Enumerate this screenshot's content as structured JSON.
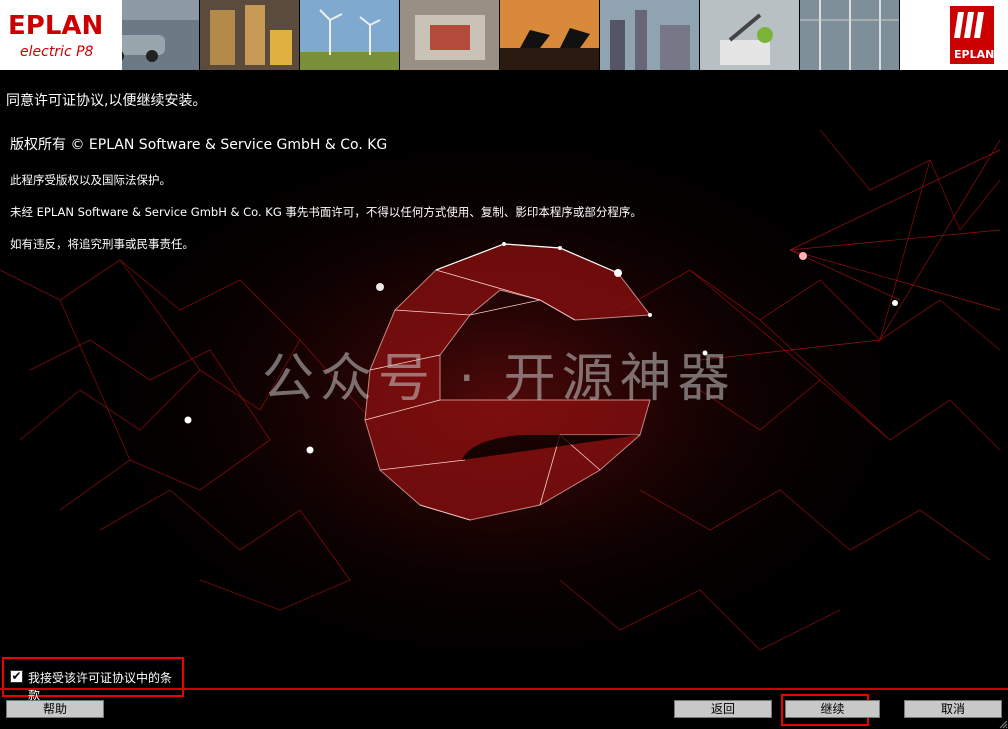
{
  "banner": {
    "logo_left_text": "EPLAN",
    "logo_left_sub": "electric P8",
    "logo_right_text": "EPLAN",
    "tiles": [
      "cars-photo",
      "warehouse-photo",
      "wind-turbines-photo",
      "machinery-photo",
      "oil-pumps-photo",
      "factory-photo",
      "robot-arm-photo",
      "substation-photo"
    ]
  },
  "heading": "同意许可证协议,以便继续安装。",
  "license": {
    "copyright": "版权所有 © EPLAN Software & Service GmbH & Co. KG",
    "line1": "此程序受版权以及国际法保护。",
    "line2": "未经 EPLAN Software & Service GmbH & Co. KG 事先书面许可，不得以任何方式使用、复制、影印本程序或部分程序。",
    "line3": "如有违反，将追究刑事或民事责任。"
  },
  "watermark": "公众号 · 开源神器",
  "accept": {
    "label": "我接受该许可证协议中的条款",
    "checked": true
  },
  "buttons": {
    "help": "帮助",
    "back": "返回",
    "next": "继续",
    "cancel": "取消"
  },
  "colors": {
    "accent": "#d00000",
    "highlight": "#ee0000",
    "button_bg": "#c8c8c8"
  }
}
